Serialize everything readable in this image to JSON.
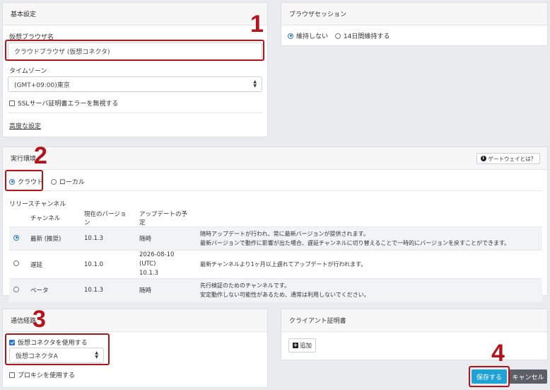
{
  "basic": {
    "title": "基本設定",
    "browser_name_label": "仮想ブラウザ名",
    "browser_name_value": "クラウドブラウザ (仮想コネクタ)",
    "timezone_label": "タイムゾーン",
    "timezone_value": "(GMT+09:00)東京",
    "ssl_ignore_label": "SSLサーバ証明書エラーを無視する",
    "advanced_link": "高度な設定"
  },
  "session": {
    "title": "ブラウザセッション",
    "option_no_keep": "維持しない",
    "option_keep_14": "14日間維持する",
    "selected": "維持しない"
  },
  "env": {
    "title": "実行環境",
    "gateway_help": "ゲートウェイとは？",
    "option_cloud": "クラウド",
    "option_local": "ローカル",
    "selected": "クラウド",
    "release_channel_label": "リリースチャンネル",
    "columns": [
      "チャンネル",
      "現在のバージョン",
      "アップデートの予定"
    ],
    "rows": [
      {
        "name": "最新 (推奨)",
        "version": "10.1.3",
        "schedule": "随時",
        "schedule2": "",
        "desc1": "随時アップデートが行われ、常に最新バージョンが提供されます。",
        "desc2": "最新バージョンで動作に影響が出た場合、遅延チャンネルに切り替えることで一時的にバージョンを戻すことができます。",
        "selected": true
      },
      {
        "name": "遅延",
        "version": "10.1.0",
        "schedule": "2026-08-10 (UTC)",
        "schedule2": "10.1.3",
        "desc1": "最新チャンネルより1ヶ月以上遅れてアップデートが行われます。",
        "desc2": "",
        "selected": false
      },
      {
        "name": "ベータ",
        "version": "10.1.3",
        "schedule": "随時",
        "schedule2": "",
        "desc1": "先行検証のためのチャンネルです。",
        "desc2": "安定動作しない可能性があるため、通常は利用しないでください。",
        "selected": false
      }
    ]
  },
  "route": {
    "title": "通信経路",
    "use_connector_label": "仮想コネクタを使用する",
    "use_connector_checked": true,
    "connector_value": "仮想コネクタA",
    "use_proxy_label": "プロキシを使用する",
    "use_proxy_checked": false
  },
  "client_cert": {
    "title": "クライアント証明書",
    "add_label": "追加"
  },
  "actions": {
    "save": "保存する",
    "cancel": "キャンセル"
  },
  "annotations": {
    "n1": "1",
    "n2": "2",
    "n3": "3",
    "n4": "4"
  },
  "colors": {
    "annotation_red": "#b5121b",
    "accent_blue": "#2b73d6",
    "save_button": "#1fa3d6",
    "cancel_button": "#5b6066"
  }
}
